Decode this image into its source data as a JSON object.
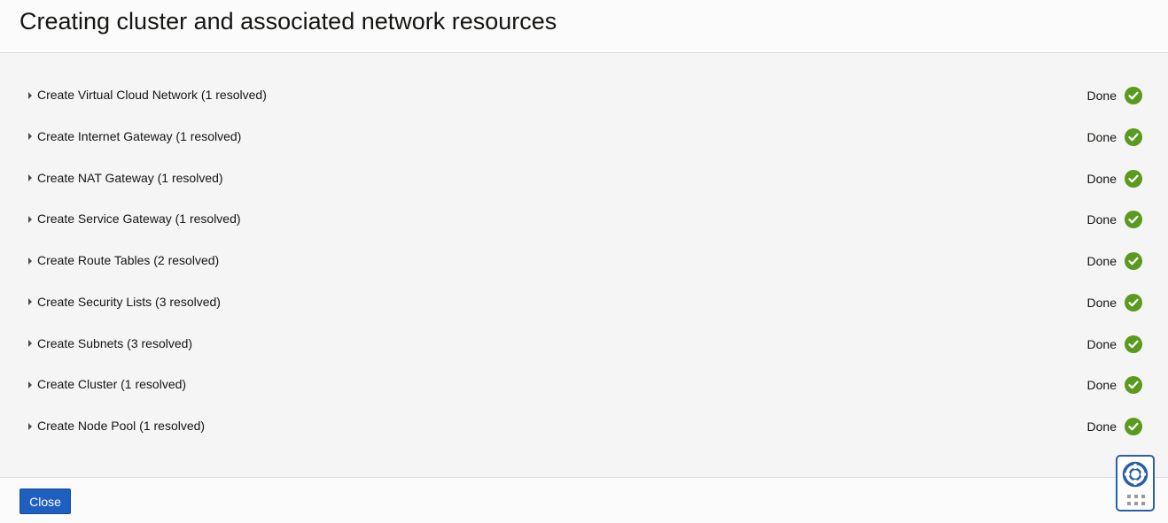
{
  "dialog": {
    "title": "Creating cluster and associated network resources"
  },
  "tasks": [
    {
      "label": "Create Virtual Cloud Network (1 resolved)",
      "status": "Done"
    },
    {
      "label": "Create Internet Gateway (1 resolved)",
      "status": "Done"
    },
    {
      "label": "Create NAT Gateway (1 resolved)",
      "status": "Done"
    },
    {
      "label": "Create Service Gateway (1 resolved)",
      "status": "Done"
    },
    {
      "label": "Create Route Tables (2 resolved)",
      "status": "Done"
    },
    {
      "label": "Create Security Lists (3 resolved)",
      "status": "Done"
    },
    {
      "label": "Create Subnets (3 resolved)",
      "status": "Done"
    },
    {
      "label": "Create Cluster (1 resolved)",
      "status": "Done"
    },
    {
      "label": "Create Node Pool (1 resolved)",
      "status": "Done"
    }
  ],
  "footer": {
    "close_label": "Close"
  },
  "icons": {
    "expander": "caret-right-icon",
    "status": "check-circle-icon",
    "help": "lifebuoy-icon",
    "help_menu": "grid-dots-icon"
  },
  "colors": {
    "success": "#5a9a1f",
    "primary_button": "#1f5fbf",
    "help_border": "#2c5ea8"
  }
}
